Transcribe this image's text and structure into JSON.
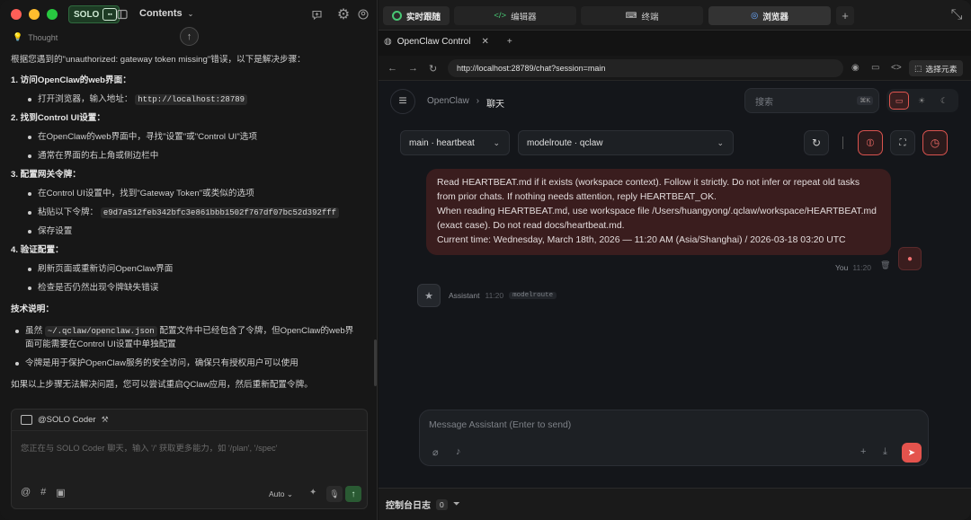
{
  "colors": {
    "close": "#ff5f57",
    "minimize": "#febc2e",
    "maximize": "#28c840",
    "accent": "#e4534d",
    "solo_green": "#2a5a33"
  },
  "left": {
    "brand": "SOLO",
    "title": "Contents",
    "thought": "Thought",
    "doc": {
      "intro": "根据您遇到的\"unauthorized: gateway token missing\"错误，以下是解决步骤：",
      "s1": "1. 访问OpenClaw的web界面：",
      "s1b1": "打开浏览器，输入地址：",
      "s1b1code": "http://localhost:28789",
      "s2": "2. 找到Control UI设置：",
      "s2b1": "在OpenClaw的web界面中，寻找\"设置\"或\"Control UI\"选项",
      "s2b2": "通常在界面的右上角或侧边栏中",
      "s3": "3. 配置网关令牌：",
      "s3b1": "在Control UI设置中，找到\"Gateway Token\"或类似的选项",
      "s3b2": "粘贴以下令牌：",
      "s3b2code": "e9d7a512feb342bfc3e861bbb1502f767df07bc52d392fff",
      "s3b3": "保存设置",
      "s4": "4. 验证配置：",
      "s4b1": "刷新页面或重新访问OpenClaw界面",
      "s4b2": "检查是否仍然出现令牌缺失错误",
      "tech": "技术说明：",
      "t1pre": "虽然",
      "t1code": "~/.qclaw/openclaw.json",
      "t1post": "配置文件中已经包含了令牌，但OpenClaw的web界",
      "t1line2": "面可能需要在Control UI设置中单独配置",
      "t2": "令牌是用于保护OpenClaw服务的安全访问，确保只有授权用户可以使用",
      "outro": "如果以上步骤无法解决问题，您可以尝试重启QClaw应用，然后重新配置令牌。"
    },
    "composer": {
      "agent": "@SOLO Coder",
      "placeholder": "您正在与 SOLO Coder 聊天，输入 '/' 获取更多能力，如 '/plan', '/spec'",
      "mode": "Auto"
    }
  },
  "right": {
    "tabs": [
      {
        "label": "实时跟随"
      },
      {
        "label": "编辑器"
      },
      {
        "label": "终端"
      },
      {
        "label": "浏览器"
      }
    ],
    "browser_tab": "OpenClaw Control",
    "url": "http://localhost:28789/chat?session=main",
    "select_element": "选择元素",
    "app": {
      "crumb_root": "OpenClaw",
      "crumb_current": "聊天",
      "search_placeholder": "搜索",
      "search_kbd": "⌘K",
      "session_select": "main · heartbeat",
      "model_select": "modelroute · qclaw",
      "message_lines": [
        "Read HEARTBEAT.md if it exists (workspace context). Follow it strictly. Do not infer or repeat old tasks",
        "from prior chats. If nothing needs attention, reply HEARTBEAT_OK.",
        "When reading HEARTBEAT.md, use workspace file /Users/huangyong/.qclaw/workspace/HEARTBEAT.md",
        "(exact case). Do not read docs/heartbeat.md.",
        "Current time: Wednesday, March 18th, 2026 — 11:20 AM (Asia/Shanghai) / 2026-03-18 03:20 UTC"
      ],
      "you_label": "You",
      "you_time": "11:20",
      "assistant_label": "Assistant",
      "assistant_time": "11:20",
      "assistant_model": "modelroute",
      "input_placeholder": "Message Assistant (Enter to send)"
    },
    "console_label": "控制台日志",
    "console_count": "0"
  }
}
